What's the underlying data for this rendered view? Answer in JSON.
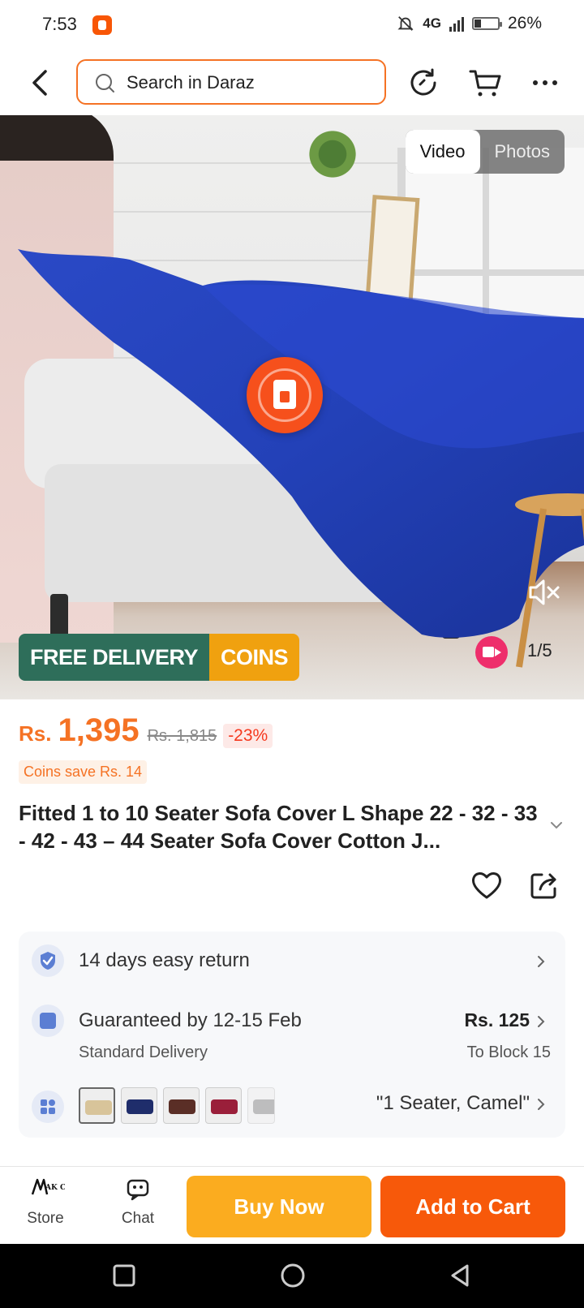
{
  "status_bar": {
    "time": "7:53",
    "network": "4G",
    "battery": "26%"
  },
  "header": {
    "search_placeholder": "Search in Daraz"
  },
  "media": {
    "toggle": [
      "Video",
      "Photos"
    ],
    "active_toggle": "Video",
    "badges": {
      "free_delivery": "FREE DELIVERY",
      "coins": "COINS"
    },
    "counter": "1/5"
  },
  "product": {
    "currency": "Rs.",
    "price": "1,395",
    "original_price": "Rs. 1,815",
    "discount": "-23%",
    "coins_save": "Coins save Rs. 14",
    "title": "Fitted 1 to 10 Seater Sofa Cover L Shape 22 - 32 - 33 - 42 - 43 – 44  Seater Sofa Cover Cotton J..."
  },
  "info": {
    "return": "14 days easy return",
    "delivery_title": "Guaranteed by 12-15 Feb",
    "delivery_type": "Standard Delivery",
    "delivery_price": "Rs. 125",
    "delivery_to": "To Block 15",
    "variant": "\"1 Seater, Camel\"",
    "variant_colors": [
      "#d8c49a",
      "#1f2d6b",
      "#5a2e26",
      "#9a1f3a",
      "#8e8e8e"
    ]
  },
  "bottom_bar": {
    "store_label": "Store",
    "store_logo": "AK Collection",
    "chat_label": "Chat",
    "buy_now": "Buy Now",
    "add_to_cart": "Add to Cart"
  },
  "colors": {
    "brand_orange": "#f57224",
    "buy_now": "#fbac1f",
    "add_to_cart": "#f7590a"
  }
}
